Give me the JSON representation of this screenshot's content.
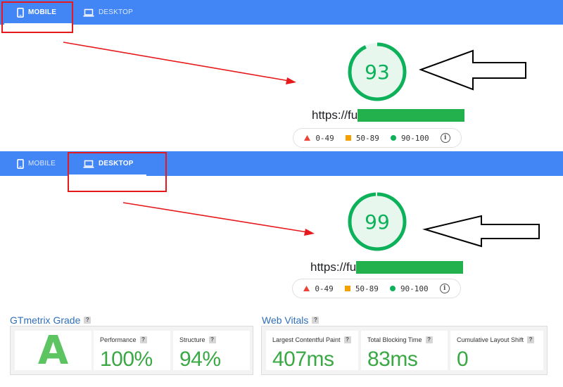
{
  "colors": {
    "tab_bar": "#4285f4",
    "annotation_red": "#e8191c",
    "score_good": "#0cb15a",
    "redaction": "#22b14c",
    "legend_fail": "#eb4335",
    "legend_average": "#f4a100",
    "legend_pass": "#0cb15a",
    "gtmetrix_blue": "#2f6fb8",
    "gtmetrix_green": "#3aa844"
  },
  "mobile_view": {
    "tabs": [
      {
        "label": "MOBILE",
        "icon": "smartphone-icon",
        "active": true
      },
      {
        "label": "DESKTOP",
        "icon": "laptop-icon",
        "active": false
      }
    ],
    "score": 93,
    "score_text": "93",
    "url_prefix": "https://fu"
  },
  "desktop_view": {
    "tabs": [
      {
        "label": "MOBILE",
        "icon": "smartphone-icon",
        "active": false
      },
      {
        "label": "DESKTOP",
        "icon": "laptop-icon",
        "active": true
      }
    ],
    "score": 99,
    "score_text": "99",
    "url_prefix": "https://fu"
  },
  "legend": {
    "fail": "0-49",
    "average": "50-89",
    "pass": "90-100",
    "info_icon": "info-icon"
  },
  "gtmetrix": {
    "grade_title": "GTmetrix Grade",
    "grade": "A",
    "performance_label": "Performance",
    "performance_value": "100%",
    "structure_label": "Structure",
    "structure_value": "94%",
    "vitals_title": "Web Vitals",
    "lcp_label": "Largest Contentful Paint",
    "lcp_value": "407ms",
    "tbt_label": "Total Blocking Time",
    "tbt_value": "83ms",
    "cls_label": "Cumulative Layout Shift",
    "cls_value": "0",
    "help_mark": "?"
  }
}
